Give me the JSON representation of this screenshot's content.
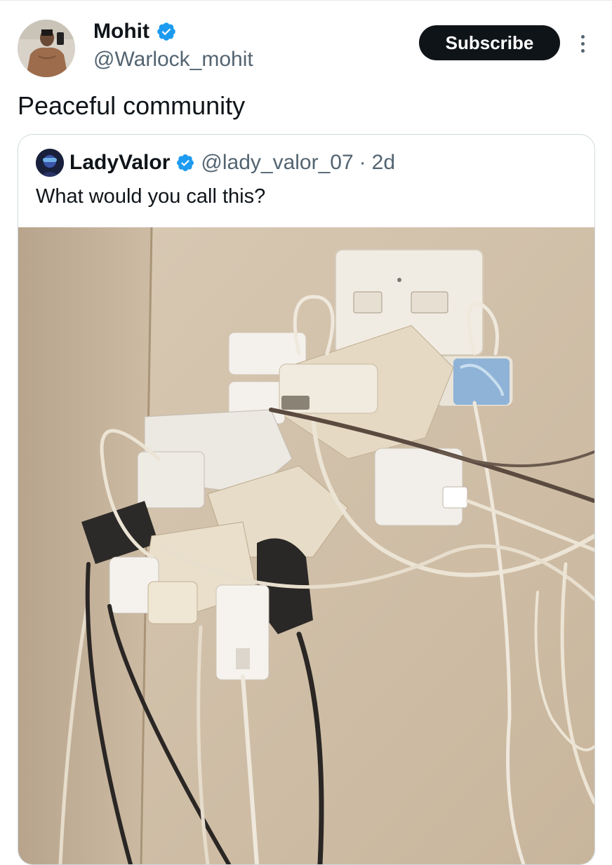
{
  "post": {
    "author_name": "Mohit",
    "author_handle": "@Warlock_mohit",
    "text": "Peaceful community",
    "subscribe_label": "Subscribe"
  },
  "quoted": {
    "author_name": "LadyValor",
    "author_handle": "@lady_valor_07",
    "separator": "·",
    "time": "2d",
    "text": "What would you call this?"
  },
  "colors": {
    "verified": "#1d9bf0",
    "text_primary": "#0f1419",
    "text_secondary": "#536471",
    "border": "#cfd9de"
  },
  "icons": {
    "verified": "verified-badge-icon",
    "more": "more-options-icon"
  }
}
